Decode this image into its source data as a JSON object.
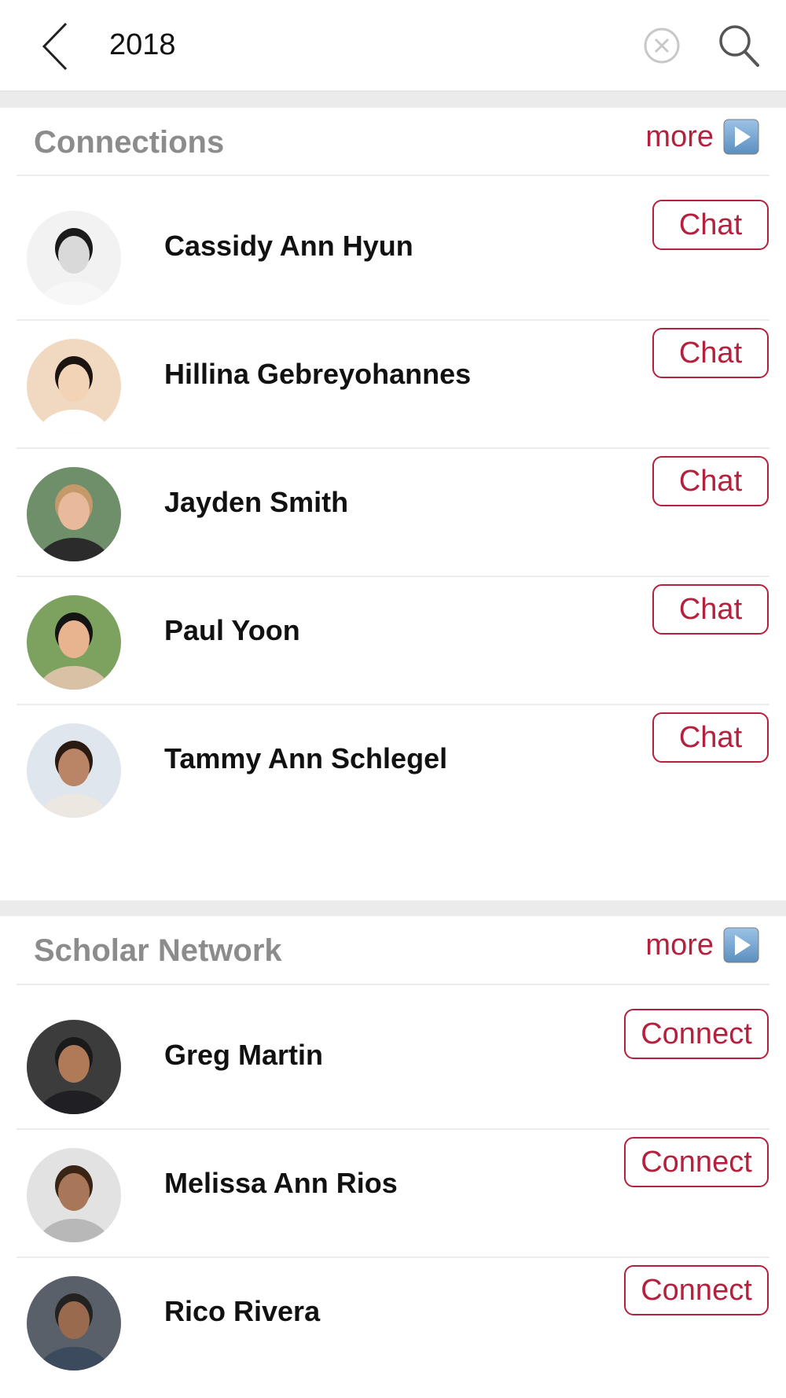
{
  "search": {
    "query": "2018"
  },
  "connections": {
    "title": "Connections",
    "more_label": "more",
    "items": [
      {
        "name": "Cassidy Ann Hyun",
        "action": "Chat"
      },
      {
        "name": "Hillina Gebreyohannes",
        "action": "Chat"
      },
      {
        "name": "Jayden Smith",
        "action": "Chat"
      },
      {
        "name": "Paul Yoon",
        "action": "Chat"
      },
      {
        "name": "Tammy Ann Schlegel",
        "action": "Chat"
      }
    ]
  },
  "scholar_network": {
    "title": "Scholar Network",
    "more_label": "more",
    "items": [
      {
        "name": "Greg Martin",
        "action": "Connect"
      },
      {
        "name": "Melissa Ann Rios",
        "action": "Connect"
      },
      {
        "name": "Rico Rivera",
        "action": "Connect"
      }
    ]
  },
  "colors": {
    "accent": "#b5213d",
    "section_title": "#8c8c8c",
    "separator": "#ebebeb"
  },
  "icons": {
    "back": "chevron-left-icon",
    "clear": "clear-circle-x-icon",
    "search": "search-icon",
    "more": "play-arrow-icon"
  }
}
